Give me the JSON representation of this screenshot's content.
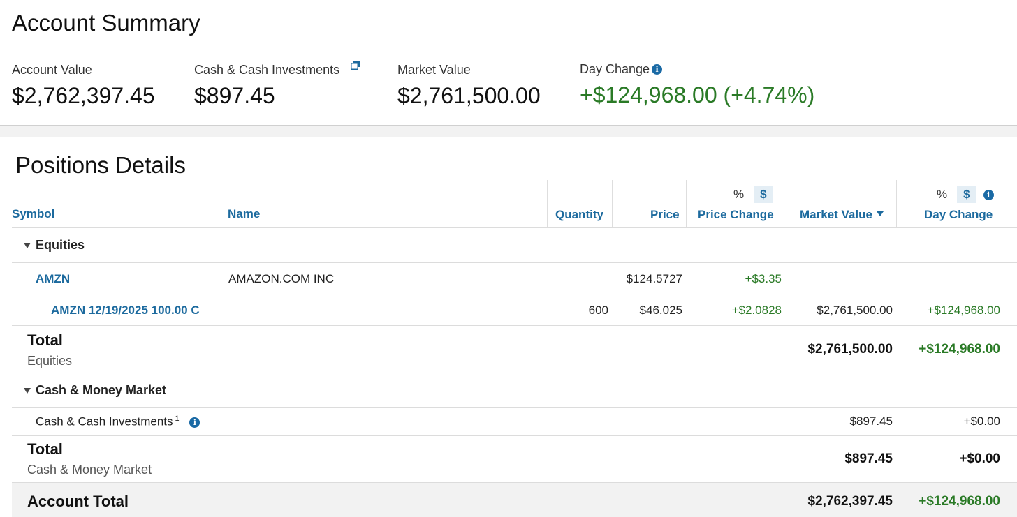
{
  "summary": {
    "title": "Account Summary",
    "account_value_label": "Account Value",
    "account_value": "$2,762,397.45",
    "cash_label": "Cash & Cash Investments",
    "cash_value": "$897.45",
    "market_value_label": "Market Value",
    "market_value": "$2,761,500.00",
    "day_change_label": "Day Change",
    "day_change_value": "+$124,968.00 (+4.74%)"
  },
  "positions": {
    "title": "Positions Details",
    "headers": {
      "symbol": "Symbol",
      "name": "Name",
      "quantity": "Quantity",
      "price": "Price",
      "price_change": "Price Change",
      "market_value": "Market Value",
      "day_change": "Day Change",
      "pct_toggle": "%",
      "dollar_toggle": "$"
    },
    "equities": {
      "group_label": "Equities",
      "rows": [
        {
          "symbol": "AMZN",
          "name": "AMAZON.COM INC",
          "quantity": "",
          "price": "$124.5727",
          "price_change": "+$3.35",
          "market_value": "",
          "day_change": ""
        },
        {
          "symbol": "AMZN 12/19/2025 100.00 C",
          "name": "",
          "quantity": "600",
          "price": "$46.025",
          "price_change": "+$2.0828",
          "market_value": "$2,761,500.00",
          "day_change": "+$124,968.00"
        }
      ],
      "total_label": "Total",
      "total_sub": "Equities",
      "total_market_value": "$2,761,500.00",
      "total_day_change": "+$124,968.00"
    },
    "cash": {
      "group_label": "Cash & Money Market",
      "row_label": "Cash & Cash Investments",
      "footnote": "1",
      "market_value": "$897.45",
      "day_change": "+$0.00",
      "total_label": "Total",
      "total_sub": "Cash & Money Market",
      "total_market_value": "$897.45",
      "total_day_change": "+$0.00"
    },
    "account_total": {
      "label": "Account Total",
      "market_value": "$2,762,397.45",
      "day_change": "+$124,968.00"
    }
  },
  "colors": {
    "link_blue": "#1c6a9e",
    "positive_green": "#2a7a26",
    "band_gray": "#f2f2f2"
  }
}
